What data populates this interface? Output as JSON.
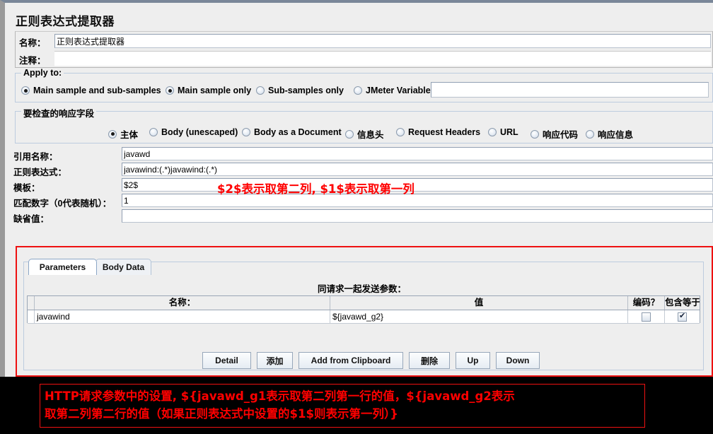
{
  "window": {
    "title": "正则表达式提取器"
  },
  "fields": {
    "name_label": "名称：",
    "name_value": "正则表达式提取器",
    "comment_label": "注释：",
    "comment_value": ""
  },
  "apply_to": {
    "legend": "Apply to:",
    "options": [
      {
        "label": "Main sample and sub-samples",
        "selected": false
      },
      {
        "label": "Main sample only",
        "selected": true
      },
      {
        "label": "Sub-samples only",
        "selected": false
      },
      {
        "label": "JMeter Variable",
        "selected": false
      }
    ],
    "variable_value": ""
  },
  "response_field": {
    "legend": "要检查的响应字段",
    "options": [
      {
        "label": "主体",
        "selected": true
      },
      {
        "label": "Body (unescaped)",
        "selected": false
      },
      {
        "label": "Body as a Document",
        "selected": false
      },
      {
        "label": "信息头",
        "selected": false
      },
      {
        "label": "Request Headers",
        "selected": false
      },
      {
        "label": "URL",
        "selected": false
      },
      {
        "label": "响应代码",
        "selected": false
      },
      {
        "label": "响应信息",
        "selected": false
      }
    ]
  },
  "extractor": {
    "refname_label": "引用名称：",
    "refname_value": "javawd",
    "regex_label": "正则表达式：",
    "regex_value": "javawind:(.*)javawind:(.*)",
    "template_label": "模板：",
    "template_value": "$2$",
    "matchno_label": "匹配数字（0代表随机）：",
    "matchno_value": "1",
    "default_label": "缺省值：",
    "default_value": ""
  },
  "annotations": {
    "inline_red": "$2$表示取第二列, $1$表示取第一列",
    "bottom_red_line1": "HTTP请求参数中的设置, ${javawd_g1表示取第二列第一行的值，${javawd_g2表示",
    "bottom_red_line2": "取第二列第二行的值（如果正则表达式中设置的$1$则表示第一列）}"
  },
  "request_panel": {
    "tabs": [
      {
        "label": "Parameters",
        "active": true
      },
      {
        "label": "Body Data",
        "active": false
      }
    ],
    "table_caption": "同请求一起发送参数：",
    "columns": [
      "",
      "名称：",
      "值",
      "编码？",
      "包含等于？"
    ],
    "rows": [
      {
        "name": "javawind",
        "value": "${javawd_g2}",
        "encode": false,
        "include_equals": true
      }
    ],
    "buttons": [
      "Detail",
      "添加",
      "Add from Clipboard",
      "删除",
      "Up",
      "Down"
    ]
  },
  "colors": {
    "annotation_red": "#ff0000",
    "frame_red": "#ee1111",
    "panel_bg": "#eeeeee",
    "bottom_bg": "#000000"
  }
}
